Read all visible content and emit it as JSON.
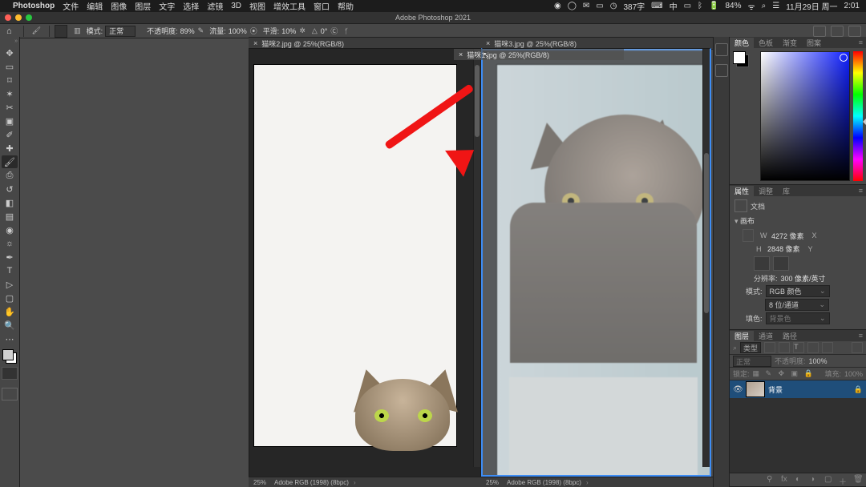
{
  "menubar": {
    "app": "Photoshop",
    "items": [
      "文件",
      "编辑",
      "图像",
      "图层",
      "文字",
      "选择",
      "滤镜",
      "3D",
      "视图",
      "增效工具",
      "窗口",
      "帮助"
    ],
    "right": {
      "typing": "387字",
      "battery": "84%",
      "date": "11月29日 周一",
      "time": "2:01"
    }
  },
  "titlebar": {
    "title": "Adobe Photoshop 2021"
  },
  "options": {
    "mode_label": "模式:",
    "mode_value": "正常",
    "opacity_label": "不透明度:",
    "opacity_value": "89%",
    "flow_label": "流量:",
    "flow_value": "100%",
    "smooth_label": "平滑:",
    "smooth_value": "10%",
    "angle_label": "",
    "angle_value": "0°"
  },
  "doc_tabs": {
    "left": "猫咪2.jpg @ 25%(RGB/8)",
    "right": "猫咪3.jpg @ 25%(RGB/8)",
    "ghost": "猫咪1.jpg @ 25%(RGB/8)"
  },
  "status": {
    "zoom": "25%",
    "profile": "Adobe RGB (1998) (8bpc)"
  },
  "panels": {
    "color": {
      "tabs": [
        "颜色",
        "色板",
        "渐变",
        "图案"
      ]
    },
    "properties": {
      "tabs": [
        "属性",
        "调整",
        "库"
      ],
      "doc_type": "文档",
      "section_canvas": "画布",
      "w_label": "W",
      "w_value": "4272 像素",
      "x_label": "X",
      "h_label": "H",
      "h_value": "2848 像素",
      "y_label": "Y",
      "res_label": "分辨率:",
      "res_value": "300 像素/英寸",
      "mode_label": "模式:",
      "mode_value": "RGB 颜色",
      "depth_value": "8 位/通道",
      "fill_label": "填色:",
      "fill_value": "背景色"
    },
    "layers": {
      "tabs": [
        "图层",
        "通道",
        "路径"
      ],
      "filter": "类型",
      "blend": "正常",
      "opacity_label": "不透明度:",
      "opacity_value": "100%",
      "lock_label": "锁定:",
      "fill_label": "填充:",
      "fill_value": "100%",
      "layer_name": "背景"
    }
  },
  "tools": {
    "list": [
      "↔",
      "▭",
      "◌",
      "⊹",
      "✂",
      "✎",
      "✐",
      "≋",
      "⌦",
      "✦",
      "✜",
      "✏",
      "⌫",
      "◧",
      "☞",
      "◐",
      "T",
      "▷",
      "⊡",
      "✋",
      "🔍",
      "⋯"
    ]
  }
}
